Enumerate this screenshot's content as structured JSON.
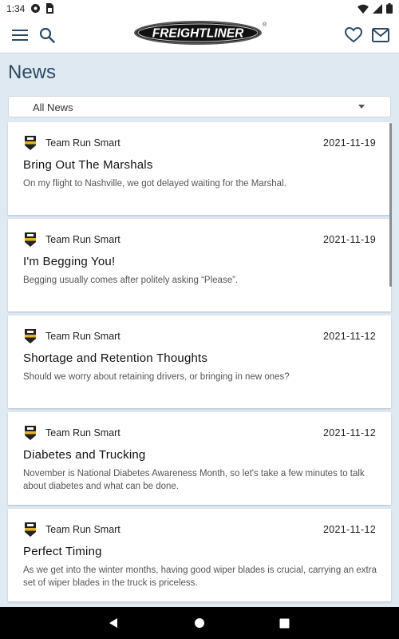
{
  "status_bar": {
    "time": "1:34",
    "left_icons": [
      "settings-icon",
      "sim-card-icon"
    ],
    "right_icons": [
      "wifi-icon",
      "signal-icon",
      "battery-icon"
    ]
  },
  "app_bar": {
    "brand": "FREIGHTLINER",
    "brand_mark": "®",
    "left_icons": [
      "menu-icon",
      "search-icon"
    ],
    "right_icons": [
      "heart-icon",
      "mail-icon"
    ]
  },
  "page": {
    "title": "News"
  },
  "filter": {
    "selected": "All News"
  },
  "colors": {
    "background": "#dfe9f1",
    "title": "#2d4a63",
    "icon": "#2d4a63",
    "card": "#ffffff"
  },
  "news": [
    {
      "author": "Team Run Smart",
      "date": "2021-11-19",
      "title": "Bring Out The Marshals",
      "excerpt": "On my flight to Nashville, we got delayed waiting for the Marshal."
    },
    {
      "author": "Team Run Smart",
      "date": "2021-11-19",
      "title": "I'm Begging You!",
      "excerpt": "Begging usually comes after politely asking “Please”."
    },
    {
      "author": "Team Run Smart",
      "date": "2021-11-12",
      "title": "Shortage and Retention Thoughts",
      "excerpt": "Should we worry about retaining drivers, or bringing in new ones?"
    },
    {
      "author": "Team Run Smart",
      "date": "2021-11-12",
      "title": "Diabetes and Trucking",
      "excerpt": "November is National Diabetes Awareness Month, so let's take a few minutes to talk about diabetes and what can be done."
    },
    {
      "author": "Team Run Smart",
      "date": "2021-11-12",
      "title": "Perfect Timing",
      "excerpt": "As we get into the winter months, having good wiper blades is crucial, carrying an extra set of wiper blades in the truck is priceless."
    }
  ],
  "nav_bar": {
    "buttons": [
      "back-icon",
      "home-icon",
      "recents-icon"
    ]
  }
}
